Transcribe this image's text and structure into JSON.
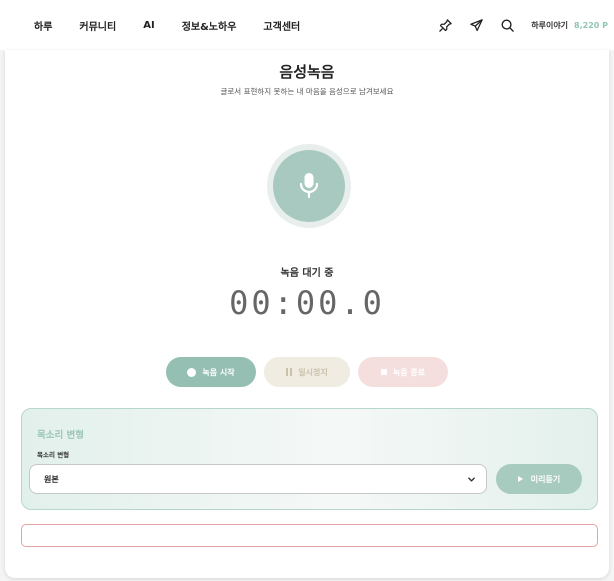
{
  "nav": {
    "links": [
      "하루",
      "커뮤니티",
      "AI",
      "정보&노하우",
      "고객센터"
    ],
    "icons": [
      "pin-icon",
      "send-icon",
      "search-icon"
    ],
    "user_name": "하루이야기",
    "points": "8,220 P"
  },
  "recorder": {
    "title": "음성녹음",
    "subtitle": "글로서 표현하지 못하는 내 마음을 음성으로 남겨보세요",
    "status": "녹음 대기 중",
    "timer": "00:00.0",
    "start_label": "녹음 시작",
    "pause_label": "일시정지",
    "stop_label": "녹음 종료"
  },
  "voice_change": {
    "title": "목소리 변형",
    "label": "목소리 변형",
    "selected": "원본",
    "preview_label": "미리듣기"
  },
  "colors": {
    "accent": "#94bfb2",
    "points": "#8fc6b6",
    "stop": "#f5dede",
    "pause": "#f1ece1",
    "error_border": "#e2a5a5"
  }
}
